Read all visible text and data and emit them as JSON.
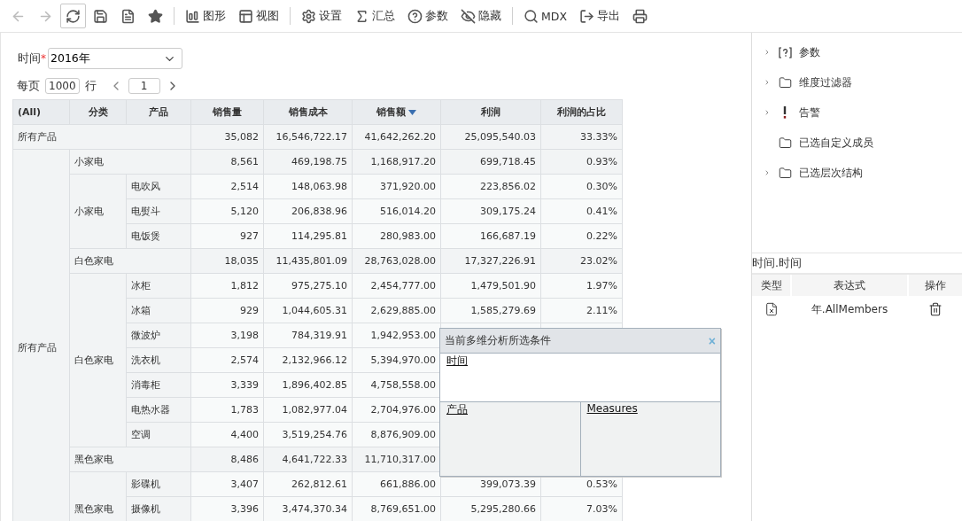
{
  "toolbar": [
    {
      "items": [
        {
          "disabled": true,
          "active": false
        },
        {
          "disabled": true,
          "active": false
        },
        {
          "disabled": false,
          "active": true
        },
        {
          "disabled": false,
          "active": false
        },
        {
          "disabled": false,
          "active": false
        },
        {
          "disabled": false,
          "active": false
        }
      ]
    },
    {
      "items": [
        {
          "label": "图形",
          "disabled": false,
          "active": false
        },
        {
          "label": "视图",
          "disabled": false,
          "active": false
        }
      ]
    },
    {
      "items": [
        {
          "label": "设置",
          "disabled": false,
          "active": false
        },
        {
          "label": "汇总",
          "disabled": false,
          "active": false
        },
        {
          "label": "参数",
          "disabled": false,
          "active": false
        },
        {
          "label": "隐藏",
          "disabled": false,
          "active": false
        }
      ]
    },
    {
      "items": [
        {
          "label": "MDX",
          "disabled": false,
          "active": false
        },
        {
          "label": "导出",
          "disabled": false,
          "active": false
        },
        {
          "disabled": false,
          "active": false
        }
      ]
    }
  ],
  "filter": {
    "label": "时间",
    "required_mark": "*",
    "value": "2016年"
  },
  "paging": {
    "per_page_label": "每页",
    "per_page": "1000",
    "rows_label": "行",
    "page": "1"
  },
  "table": {
    "columns": [
      {
        "label": "(All)",
        "sorted": false
      },
      {
        "label": "分类",
        "sorted": false
      },
      {
        "label": "产品",
        "sorted": false
      },
      {
        "label": "销售量",
        "sorted": false
      },
      {
        "label": "销售成本",
        "sorted": false
      },
      {
        "label": "销售额",
        "sorted": true
      },
      {
        "label": "利润",
        "sorted": false
      },
      {
        "label": "利润的占比",
        "sorted": false
      }
    ],
    "total": {
      "label": "所有产品",
      "values": [
        "35,082",
        "16,546,722.17",
        "41,642,262.20",
        "25,095,540.03",
        "33.33%"
      ]
    },
    "all_label": "所有产品",
    "categories": [
      {
        "label": "小家电",
        "values": [
          "8,561",
          "469,198.75",
          "1,168,917.20",
          "699,718.45",
          "0.93%"
        ],
        "group_label": "小家电",
        "products": [
          {
            "label": "电吹风",
            "values": [
              "2,514",
              "148,063.98",
              "371,920.00",
              "223,856.02",
              "0.30%"
            ]
          },
          {
            "label": "电熨斗",
            "values": [
              "5,120",
              "206,838.96",
              "516,014.20",
              "309,175.24",
              "0.41%"
            ]
          },
          {
            "label": "电饭煲",
            "values": [
              "927",
              "114,295.81",
              "280,983.00",
              "166,687.19",
              "0.22%"
            ]
          }
        ]
      },
      {
        "label": "白色家电",
        "values": [
          "18,035",
          "11,435,801.09",
          "28,763,028.00",
          "17,327,226.91",
          "23.02%"
        ],
        "group_label": "白色家电",
        "products": [
          {
            "label": "冰柜",
            "values": [
              "1,812",
              "975,275.10",
              "2,454,777.00",
              "1,479,501.90",
              "1.97%"
            ]
          },
          {
            "label": "冰箱",
            "values": [
              "929",
              "1,044,605.31",
              "2,629,885.00",
              "1,585,279.69",
              "2.11%"
            ]
          },
          {
            "label": "微波炉",
            "values": [
              "3,198",
              "784,319.91",
              "1,942,953.00"
            ]
          },
          {
            "label": "洗衣机",
            "values": [
              "2,574",
              "2,132,966.12",
              "5,394,970.00"
            ]
          },
          {
            "label": "消毒柜",
            "values": [
              "3,339",
              "1,896,402.85",
              "4,758,558.00"
            ]
          },
          {
            "label": "电热水器",
            "values": [
              "1,783",
              "1,082,977.04",
              "2,704,976.00"
            ]
          },
          {
            "label": "空调",
            "values": [
              "4,400",
              "3,519,254.76",
              "8,876,909.00"
            ]
          }
        ]
      },
      {
        "label": "黑色家电",
        "values": [
          "8,486",
          "4,641,722.33",
          "11,710,317.00"
        ],
        "group_label": "黑色家电",
        "products": [
          {
            "label": "影碟机",
            "values": [
              "3,407",
              "262,812.61",
              "661,886.00",
              "399,073.39",
              "0.53%"
            ]
          },
          {
            "label": "摄像机",
            "values": [
              "3,396",
              "3,474,370.34",
              "8,769,651.00",
              "5,295,280.66",
              "7.03%"
            ]
          }
        ]
      }
    ]
  },
  "popup": {
    "title": "当前多维分析所选条件",
    "close": "×",
    "top_link": "时间",
    "left_link": "产品",
    "right_link": "Measures"
  },
  "tree": [
    {
      "label": "参数",
      "expandable": true
    },
    {
      "label": "维度过滤器",
      "expandable": true
    },
    {
      "label": "告警",
      "expandable": true
    },
    {
      "label": "已选自定义成员",
      "expandable": false
    },
    {
      "label": "已选层次结构",
      "expandable": true
    }
  ],
  "detail": {
    "title": "时间.时间",
    "columns": [
      "类型",
      "表达式",
      "操作"
    ],
    "rows": [
      {
        "expression": "年.AllMembers"
      }
    ]
  }
}
